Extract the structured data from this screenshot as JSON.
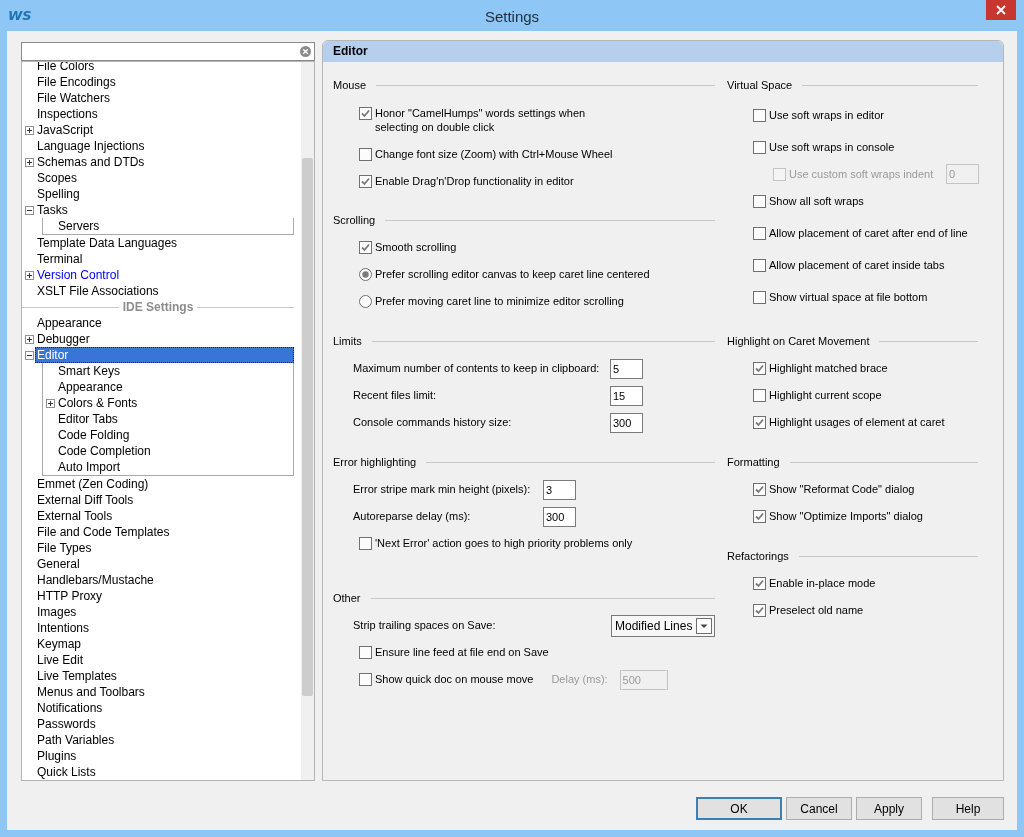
{
  "window": {
    "title": "Settings",
    "logo": "WS"
  },
  "tree": {
    "items": [
      {
        "label": "File Colors",
        "selected": false
      },
      {
        "label": "File Encodings",
        "selected": false
      },
      {
        "label": "File Watchers",
        "selected": false
      },
      {
        "label": "Inspections",
        "selected": false
      },
      {
        "label": "JavaScript",
        "selected": false,
        "expanded": false
      },
      {
        "label": "Language Injections",
        "selected": false
      },
      {
        "label": "Schemas and DTDs",
        "selected": false,
        "expanded": false
      },
      {
        "label": "Scopes",
        "selected": false
      },
      {
        "label": "Spelling",
        "selected": false
      },
      {
        "label": "Tasks",
        "selected": false,
        "expanded": true,
        "children": [
          {
            "label": "Servers",
            "selected": false
          }
        ]
      },
      {
        "label": "Template Data Languages",
        "selected": false
      },
      {
        "label": "Terminal",
        "selected": false
      },
      {
        "label": "Version Control",
        "selected": false,
        "expanded": false,
        "color": "#0000ff"
      },
      {
        "label": "XSLT File Associations",
        "selected": false
      }
    ],
    "separator": "IDE Settings",
    "ide_items": [
      {
        "label": "Appearance",
        "selected": false
      },
      {
        "label": "Debugger",
        "selected": false,
        "expanded": false
      },
      {
        "label": "Editor",
        "selected": true,
        "expanded": true,
        "children": [
          {
            "label": "Smart Keys",
            "selected": false
          },
          {
            "label": "Appearance",
            "selected": false
          },
          {
            "label": "Colors & Fonts",
            "selected": false,
            "expanded": false
          },
          {
            "label": "Editor Tabs",
            "selected": false
          },
          {
            "label": "Code Folding",
            "selected": false
          },
          {
            "label": "Code Completion",
            "selected": false
          },
          {
            "label": "Auto Import",
            "selected": false
          }
        ]
      },
      {
        "label": "Emmet (Zen Coding)",
        "selected": false
      },
      {
        "label": "External Diff Tools",
        "selected": false
      },
      {
        "label": "External Tools",
        "selected": false
      },
      {
        "label": "File and Code Templates",
        "selected": false
      },
      {
        "label": "File Types",
        "selected": false
      },
      {
        "label": "General",
        "selected": false
      },
      {
        "label": "Handlebars/Mustache",
        "selected": false
      },
      {
        "label": "HTTP Proxy",
        "selected": false
      },
      {
        "label": "Images",
        "selected": false
      },
      {
        "label": "Intentions",
        "selected": false
      },
      {
        "label": "Keymap",
        "selected": false
      },
      {
        "label": "Live Edit",
        "selected": false
      },
      {
        "label": "Live Templates",
        "selected": false
      },
      {
        "label": "Menus and Toolbars",
        "selected": false
      },
      {
        "label": "Notifications",
        "selected": false
      },
      {
        "label": "Passwords",
        "selected": false
      },
      {
        "label": "Path Variables",
        "selected": false
      },
      {
        "label": "Plugins",
        "selected": false
      },
      {
        "label": "Quick Lists",
        "selected": false
      }
    ]
  },
  "panel": {
    "title": "Editor",
    "left_sections": [
      {
        "title": "Mouse",
        "items": [
          {
            "kind": "checkbox",
            "label": "Honor \"CamelHumps\" words settings when selecting on double click",
            "checked": true
          },
          {
            "kind": "checkbox",
            "label": "Change font size (Zoom) with Ctrl+Mouse Wheel",
            "checked": false
          },
          {
            "kind": "checkbox",
            "label": "Enable Drag'n'Drop functionality in editor",
            "checked": true
          }
        ]
      },
      {
        "title": "Scrolling",
        "items": [
          {
            "kind": "checkbox",
            "label": "Smooth scrolling",
            "checked": true
          },
          {
            "kind": "radio",
            "label": "Prefer scrolling editor canvas to keep caret line centered",
            "selected": true
          },
          {
            "kind": "radio",
            "label": "Prefer moving caret line to minimize editor scrolling",
            "selected": false
          }
        ]
      },
      {
        "title": "Limits",
        "items": [
          {
            "kind": "field",
            "label": "Maximum number of contents to keep in clipboard:",
            "value": "5"
          },
          {
            "kind": "field",
            "label": "Recent files limit:",
            "value": "15"
          },
          {
            "kind": "field",
            "label": "Console commands history size:",
            "value": "300"
          }
        ]
      },
      {
        "title": "Error highlighting",
        "items": [
          {
            "kind": "field",
            "label": "Error stripe mark min height (pixels):",
            "value": "3"
          },
          {
            "kind": "field",
            "label": "Autoreparse delay (ms):",
            "value": "300"
          },
          {
            "kind": "checkbox",
            "label": "'Next Error' action goes to high priority problems only",
            "checked": false
          }
        ]
      },
      {
        "title": "Other",
        "items": [
          {
            "kind": "select",
            "label": "Strip trailing spaces on Save:",
            "value": "Modified Lines"
          },
          {
            "kind": "checkbox",
            "label": "Ensure line feed at file end on Save",
            "checked": false
          },
          {
            "kind": "checkbox_field",
            "label": "Show quick doc on mouse move",
            "checked": false,
            "field_label": "Delay (ms):",
            "value": "500",
            "disabled": true
          }
        ]
      }
    ],
    "right_sections": [
      {
        "title": "Virtual Space",
        "items": [
          {
            "kind": "checkbox",
            "label": "Use soft wraps in editor",
            "checked": false
          },
          {
            "kind": "checkbox",
            "label": "Use soft wraps in console",
            "checked": false,
            "children": [
              {
                "kind": "checkbox_field",
                "label": "Use custom soft wraps indent",
                "checked": false,
                "value": "0",
                "disabled": true
              }
            ]
          },
          {
            "kind": "checkbox",
            "label": "Show all soft wraps",
            "checked": false
          },
          {
            "kind": "checkbox",
            "label": "Allow placement of caret after end of line",
            "checked": false
          },
          {
            "kind": "checkbox",
            "label": "Allow placement of caret inside tabs",
            "checked": false
          },
          {
            "kind": "checkbox",
            "label": "Show virtual space at file bottom",
            "checked": false
          }
        ]
      },
      {
        "title": "Highlight on Caret Movement",
        "items": [
          {
            "kind": "checkbox",
            "label": "Highlight matched brace",
            "checked": true
          },
          {
            "kind": "checkbox",
            "label": "Highlight current scope",
            "checked": false
          },
          {
            "kind": "checkbox",
            "label": "Highlight usages of element at caret",
            "checked": true
          }
        ]
      },
      {
        "title": "Formatting",
        "items": [
          {
            "kind": "checkbox",
            "label": "Show \"Reformat Code\" dialog",
            "checked": true
          },
          {
            "kind": "checkbox",
            "label": "Show \"Optimize Imports\" dialog",
            "checked": true
          }
        ]
      },
      {
        "title": "Refactorings",
        "items": [
          {
            "kind": "checkbox",
            "label": "Enable in-place mode",
            "checked": true
          },
          {
            "kind": "checkbox",
            "label": "Preselect old name",
            "checked": true
          }
        ]
      }
    ]
  },
  "buttons": [
    {
      "label": "OK",
      "default": true
    },
    {
      "label": "Cancel",
      "default": false
    },
    {
      "label": "Apply",
      "default": false
    },
    {
      "label": "Help",
      "default": false
    }
  ]
}
